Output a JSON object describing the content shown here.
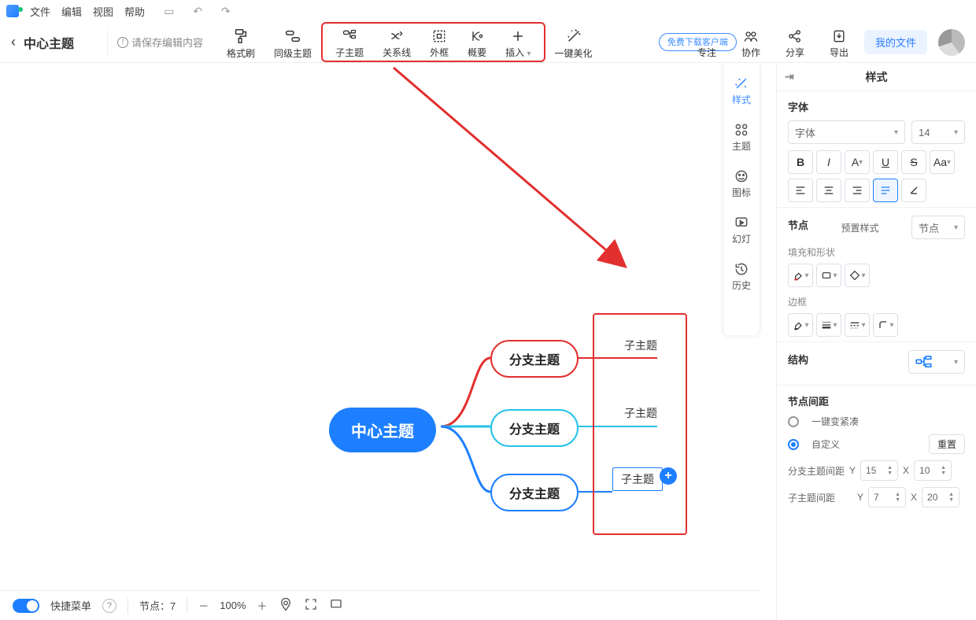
{
  "menu": {
    "file": "文件",
    "edit": "编辑",
    "view": "视图",
    "help": "帮助"
  },
  "doc": {
    "title": "中心主题",
    "save_notice": "请保存编辑内容"
  },
  "toolbar": {
    "format_painter": "格式刷",
    "same_level": "同级主题",
    "child": "子主题",
    "relation": "关系线",
    "frame": "外框",
    "summary": "概要",
    "insert": "插入",
    "beautify": "一键美化",
    "focus": "专注",
    "collab": "协作",
    "share": "分享",
    "export": "导出",
    "free_badge": "免费下载客户端",
    "my_files": "我的文件"
  },
  "canvas": {
    "center": "中心主题",
    "branches": [
      "分支主题",
      "分支主题",
      "分支主题"
    ],
    "leaves": [
      "子主题",
      "子主题",
      "子主题"
    ]
  },
  "side_tabs": {
    "style": "样式",
    "theme": "主题",
    "icon": "图标",
    "slide": "幻灯",
    "history": "历史"
  },
  "panel": {
    "title": "样式",
    "font_section": "字体",
    "font_family_placeholder": "字体",
    "font_size": "14",
    "node_section": "节点",
    "preset_label": "预置样式",
    "preset_value": "节点",
    "fill_shape": "填充和形状",
    "border": "边框",
    "structure": "结构",
    "spacing_section": "节点间距",
    "compact": "一键变紧凑",
    "custom": "自定义",
    "reset": "重置",
    "branch_spacing": "分支主题间距",
    "child_spacing": "子主题间距",
    "vals": {
      "by": "15",
      "bx": "10",
      "cy": "7",
      "cx": "20"
    }
  },
  "status": {
    "quickmenu": "快捷菜单",
    "nodecount_label": "节点：",
    "nodecount": "7",
    "zoom": "100%"
  }
}
